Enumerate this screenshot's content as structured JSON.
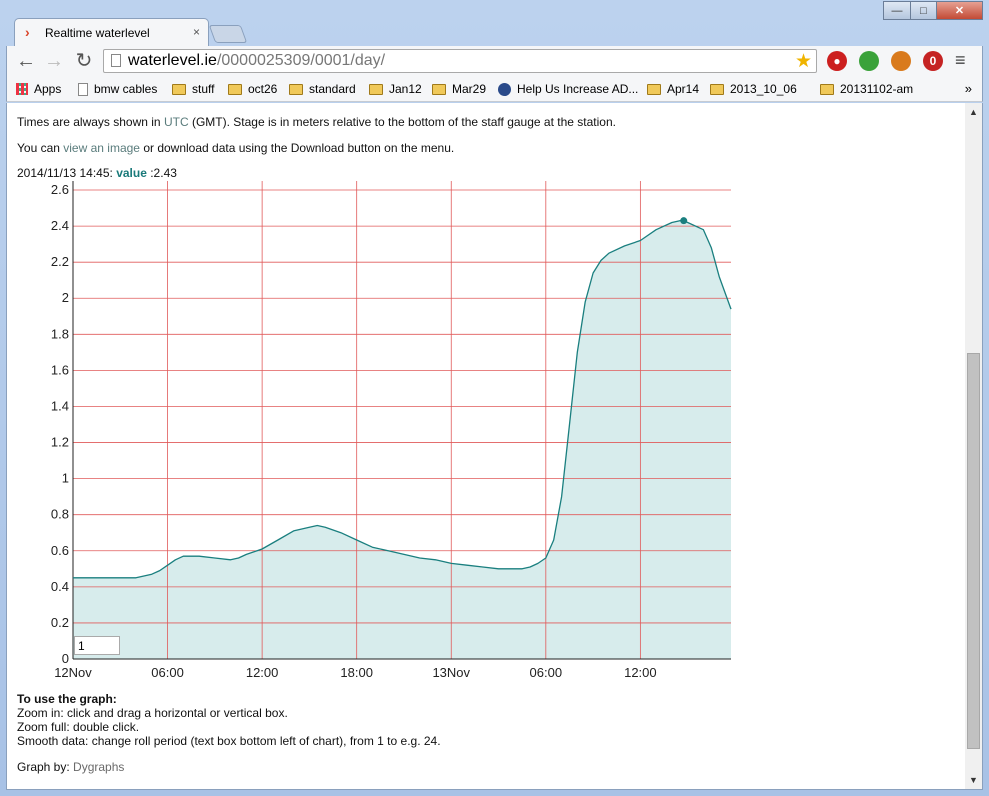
{
  "window": {
    "tab_title": "Realtime waterlevel",
    "tab_close": "×",
    "controls": {
      "min": "—",
      "max": "□",
      "close": "✕"
    }
  },
  "toolbar": {
    "url_host": "waterlevel.ie",
    "url_path": "/0000025309/0001/day/",
    "icons": [
      "back-arrow-icon",
      "forward-arrow-icon",
      "reload-icon",
      "page-icon",
      "star-icon",
      "stop-extension-icon",
      "green-pin-extension-icon",
      "globe-extension-icon",
      "red-badge-extension-icon",
      "menu-icon"
    ],
    "ext_badge": "0"
  },
  "bookmarks": {
    "items": [
      {
        "label": "Apps",
        "icon": "apps-icon"
      },
      {
        "label": "bmw cables",
        "icon": "page-icon"
      },
      {
        "label": "stuff",
        "icon": "folder-icon"
      },
      {
        "label": "oct26",
        "icon": "folder-icon"
      },
      {
        "label": "standard",
        "icon": "folder-icon"
      },
      {
        "label": "Jan12",
        "icon": "folder-icon"
      },
      {
        "label": "Mar29",
        "icon": "folder-icon"
      },
      {
        "label": "Help Us Increase AD...",
        "icon": "globe-icon"
      },
      {
        "label": "Apr14",
        "icon": "folder-icon"
      },
      {
        "label": "2013_10_06",
        "icon": "folder-icon"
      },
      {
        "label": "20131102-am",
        "icon": "folder-icon"
      }
    ],
    "more": "»"
  },
  "content": {
    "intro1_a": "Times are always shown in ",
    "intro1_link": "UTC",
    "intro1_b": " (GMT). Stage is in meters relative to the bottom of the staff gauge at the station.",
    "intro2_a": "You can ",
    "intro2_link": "view an image",
    "intro2_b": " or download data using the Download button on the menu.",
    "legend_time": "2014/11/13 14:45: ",
    "legend_name": "value",
    "legend_value": " :2.43",
    "roll_period": "1",
    "howto_title": "To use the graph:",
    "howto_1": "Zoom in: click and drag a horizontal or vertical box.",
    "howto_2": "Zoom full: double click.",
    "howto_3": "Smooth data: change roll period (text box bottom left of chart), from 1 to e.g. 24.",
    "graph_by": "Graph by: ",
    "graph_by_link": "Dygraphs"
  },
  "chart_data": {
    "type": "area",
    "x_unit": "hours since 12Nov 00:00 UTC",
    "x_tick_labels": [
      "12Nov",
      "06:00",
      "12:00",
      "18:00",
      "13Nov",
      "06:00",
      "12:00"
    ],
    "x_ticks": [
      0,
      6,
      12,
      18,
      24,
      30,
      36
    ],
    "xlim": [
      0,
      41.75
    ],
    "ylim": [
      0,
      2.65
    ],
    "y_ticks": [
      0,
      0.2,
      0.4,
      0.6,
      0.8,
      1,
      1.2,
      1.4,
      1.6,
      1.8,
      2,
      2.2,
      2.4,
      2.6
    ],
    "y_tick_labels": [
      "0",
      "0.2",
      "0.4",
      "0.6",
      "0.8",
      "1",
      "1.2",
      "1.4",
      "1.6",
      "1.8",
      "2",
      "2.2",
      "2.4",
      "2.6"
    ],
    "grid": true,
    "line_color": "#1a7f7f",
    "fill_color": "#d7ecec",
    "grid_color": "#e05a5a",
    "highlight": {
      "x": 38.75,
      "y": 2.43
    },
    "series": [
      {
        "x": [
          0,
          1,
          2,
          3,
          4,
          5,
          5.5,
          6,
          6.5,
          7,
          8,
          9,
          10,
          10.5,
          11,
          12,
          13,
          14,
          15,
          15.5,
          16,
          17,
          18,
          19,
          20,
          21,
          22,
          23,
          24,
          25,
          26,
          27,
          28,
          28.5,
          29,
          29.5,
          30,
          30.5,
          31,
          31.5,
          32,
          32.5,
          33,
          33.5,
          34,
          35,
          36,
          37,
          38,
          38.5,
          38.75,
          39,
          40,
          40.5,
          41,
          41.75
        ],
        "y": [
          0.45,
          0.45,
          0.45,
          0.45,
          0.45,
          0.47,
          0.49,
          0.52,
          0.55,
          0.57,
          0.57,
          0.56,
          0.55,
          0.56,
          0.58,
          0.61,
          0.66,
          0.71,
          0.73,
          0.74,
          0.73,
          0.7,
          0.66,
          0.62,
          0.6,
          0.58,
          0.56,
          0.55,
          0.53,
          0.52,
          0.51,
          0.5,
          0.5,
          0.5,
          0.51,
          0.53,
          0.56,
          0.66,
          0.9,
          1.3,
          1.7,
          1.98,
          2.14,
          2.21,
          2.25,
          2.29,
          2.32,
          2.38,
          2.42,
          2.43,
          2.43,
          2.42,
          2.38,
          2.28,
          2.12,
          1.94
        ]
      }
    ]
  }
}
